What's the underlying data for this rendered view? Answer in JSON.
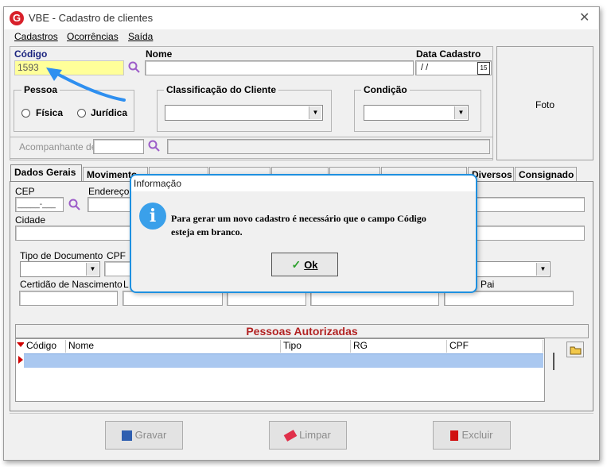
{
  "window": {
    "title": "VBE - Cadastro de clientes",
    "close": "✕",
    "logo": "G"
  },
  "menu": {
    "items": [
      "Cadastros",
      "Ocorrências",
      "Saída"
    ]
  },
  "header": {
    "codigo_label": "Código",
    "codigo_value": "1593",
    "nome_label": "Nome",
    "data_cadastro_label": "Data Cadastro",
    "data_cadastro_value": " / /",
    "calendar_day": "15",
    "foto_label": "Foto"
  },
  "pessoa": {
    "title": "Pessoa",
    "options": [
      "Física",
      "Jurídica"
    ]
  },
  "classificacao": {
    "title": "Classificação do Cliente"
  },
  "condicao": {
    "title": "Condição"
  },
  "acompanhante_label": "Acompanhante de",
  "tabs": [
    "Dados Gerais",
    "Movimento",
    "",
    "",
    "",
    "",
    "",
    "Diversos",
    "Consignado"
  ],
  "dados": {
    "cep_label": "CEP",
    "cep_mask": "_____-___",
    "endereco_label": "Endereço",
    "cidade_label": "Cidade",
    "tipo_documento_label": "Tipo de Documento",
    "cpf_label": "CPF",
    "certidao_label": "Certidão de Nascimento",
    "l_label": "L",
    "pai_label": "Pai"
  },
  "autorizadas": {
    "title": "Pessoas Autorizadas",
    "columns": [
      "Código",
      "Nome",
      "Tipo",
      "RG",
      "CPF"
    ]
  },
  "buttons": {
    "gravar": "Gravar",
    "limpar": "Limpar",
    "excluir": "Excluir"
  },
  "dialog": {
    "title": "Informação",
    "message_line1": "Para gerar um novo cadastro é necessário que o campo Código",
    "message_line2": "esteja em branco.",
    "ok": "Ok",
    "info_icon": "i"
  },
  "colors": {
    "accent": "#1e90e0",
    "code_bg": "#ffff99",
    "grid_title": "#b22222",
    "grid_selected": "#aac8f0",
    "brand": "#d8202a"
  }
}
